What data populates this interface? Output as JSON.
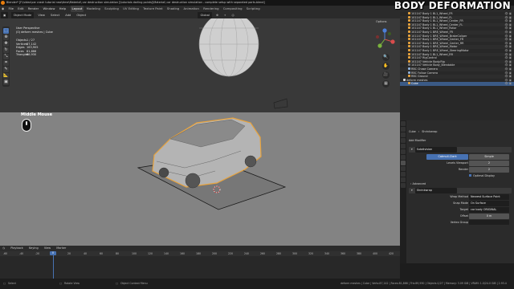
{
  "title_bar": "Blender* [F:\\video\\car crash tutorial new\\time\\Material\\ car destruction simulation [\\tutorials darling points]\\Material\\ car destruction simulation - complete setup with separated parts.blend]",
  "brand": "BODY DEFORMATION",
  "menu": [
    "File",
    "Edit",
    "Render",
    "Window",
    "Help"
  ],
  "workspaces": [
    "Layout",
    "Modeling",
    "Sculpting",
    "UV Editing",
    "Texture Paint",
    "Shading",
    "Animation",
    "Rendering",
    "Compositing",
    "Scripting"
  ],
  "active_workspace": "Layout",
  "viewport_header": {
    "mode": "Object Mode",
    "menus": [
      "View",
      "Select",
      "Add",
      "Object"
    ],
    "orientation": "Global"
  },
  "options_label": "Options",
  "viewport_info": {
    "line1": "User Perspective",
    "line2": "(0) deform meshes | Cube"
  },
  "stats": [
    {
      "k": "Objects",
      "v": "1 / 27"
    },
    {
      "k": "Vertices",
      "v": "87,142"
    },
    {
      "k": "Edges",
      "v": "163,905"
    },
    {
      "k": "Faces",
      "v": "81,866"
    },
    {
      "k": "Triangles",
      "v": "89,930"
    }
  ],
  "mouse_hint": "Middle Mouse",
  "tools": [
    "select",
    "cursor",
    "move",
    "rotate",
    "scale",
    "transform",
    "annotate",
    "measure",
    "add-cube"
  ],
  "outliner": [
    {
      "label": "101147 Body 1 BL1_Wheel_FR",
      "color": "#e8a33d"
    },
    {
      "label": "101147 Body 1 BL1_Wheel_FL",
      "color": "#e8a33d"
    },
    {
      "label": "101147 Body 1 BL1_Wheel_Center_FR",
      "color": "#e8a33d"
    },
    {
      "label": "101147 Body 1 BL1_Wheel_Center_FL",
      "color": "#e8a33d"
    },
    {
      "label": "101147 Body 1 BL1_Wheel_Rotor",
      "color": "#e8a33d"
    },
    {
      "label": "101147 Body 1 BRE_Wheel_FR",
      "color": "#e8a33d"
    },
    {
      "label": "101147 Body 1 BRE_Wheel_BrakeCaliper",
      "color": "#e8a33d"
    },
    {
      "label": "101147 Body 1 BRE_Wheel_Center_FR",
      "color": "#e8a33d"
    },
    {
      "label": "101147 Body 1 BRE_Wheel_Center_RR",
      "color": "#e8a33d"
    },
    {
      "label": "101147 Body 1 BRE_Wheel_Motor",
      "color": "#e8a33d"
    },
    {
      "label": "101147 Body 1 BRE_Wheel_SteeringMotor",
      "color": "#e8a33d"
    },
    {
      "label": "101147 Body 1 BL1_Wheel_RR",
      "color": "#e8a33d"
    },
    {
      "label": "101147 RigControl",
      "color": "#e8a33d"
    },
    {
      "label": "101147 Vehicle Body.Rig",
      "color": "#e8a33d"
    },
    {
      "label": "101147 Vehicle Body_Blendable",
      "color": "#777777"
    },
    {
      "label": "RBC Chase Camera",
      "color": "#8fb0d8"
    },
    {
      "label": "RBC Follow Camera",
      "color": "#8fb0d8"
    },
    {
      "label": "RBC Ground",
      "color": "#e8a33d"
    },
    {
      "label": "deform meshes",
      "color": "#dddddd"
    },
    {
      "label": "Cube",
      "color": "#e8a33d"
    }
  ],
  "selected_outliner": "Cube",
  "props": {
    "breadcrumb_obj": "Cube",
    "breadcrumb_mod": "Shrinkwrap",
    "add_modifier": "Add Modifier",
    "mod1_name": "Subdivision",
    "catmull": "Catmull-Clark",
    "simple": "Simple",
    "levels_label": "Levels Viewport",
    "levels_value": "2",
    "render_label": "Render",
    "render_value": "2",
    "optimal": "Optimal Display",
    "advanced": "Advanced",
    "mod2_name": "Shrinkwrap",
    "wrap_label": "Wrap Method",
    "wrap_value": "Nearest Surface Point",
    "snap_label": "Snap Mode",
    "snap_value": "On Surface",
    "target_label": "Target",
    "target_value": "car body ORIGINAL",
    "offset_label": "Offset",
    "offset_value": "0 m",
    "vgroup_label": "Vertex Group"
  },
  "timeline_header": [
    "Playback",
    "Keying",
    "View",
    "Marker"
  ],
  "timeline_ticks": [
    "-60",
    "-40",
    "-20",
    "0",
    "20",
    "40",
    "60",
    "80",
    "100",
    "120",
    "140",
    "160",
    "180",
    "200",
    "220",
    "240",
    "260",
    "280",
    "300",
    "320",
    "340",
    "360",
    "380",
    "400",
    "420"
  ],
  "current_frame": "0",
  "status": {
    "left": "Select",
    "mid1": "Rotate View",
    "mid2": "Object Context Menu",
    "right": "deform meshes | Cube | Verts:87,142 | Faces:81,866 | Tris:89,930 | Objects:1/27 | Memory: 3.09 GiB | VRAM: 1.0/24.0 GiB | 2.93.4"
  },
  "colors": {
    "accent": "#4772b3",
    "selection_outline": "#e8a33d",
    "brand_text": "#ffffff"
  }
}
